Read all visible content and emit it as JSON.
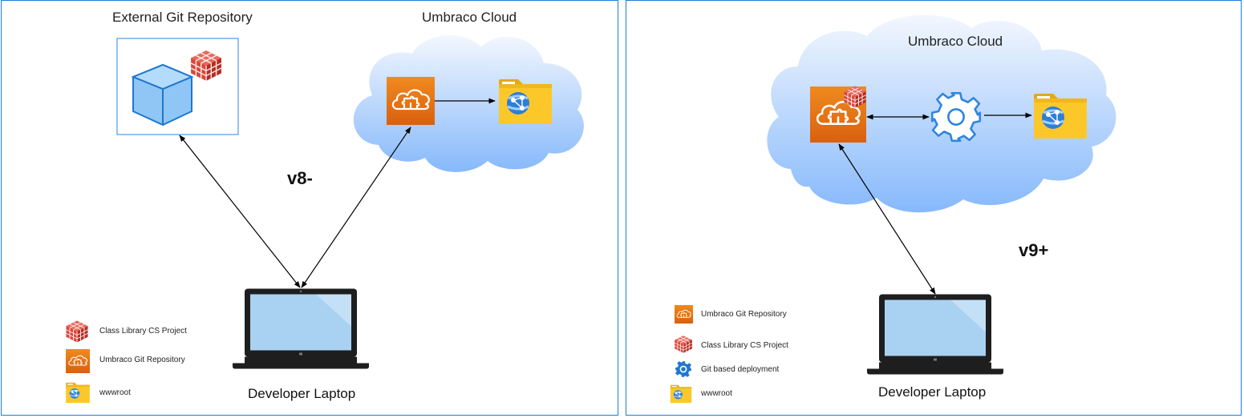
{
  "left": {
    "git_repo_title": "External Git Repository",
    "cloud_title": "Umbraco Cloud",
    "version_label": "v8-",
    "laptop_label": "Developer Laptop",
    "legend": {
      "class_library": "Class Library CS Project",
      "umbraco_git": "Umbraco Git Repository",
      "wwwroot": "wwwroot"
    }
  },
  "right": {
    "cloud_title": "Umbraco Cloud",
    "version_label": "v9+",
    "laptop_label": "Developer Laptop",
    "legend": {
      "umbraco_git": "Umbraco Git Repository",
      "class_library": "Class Library CS Project",
      "git_deploy": "Git based deployment",
      "wwwroot": "wwwroot"
    }
  },
  "icons": {
    "cube": "cube-icon",
    "brick": "brick-stack-icon",
    "umbraco": "cloud-puzzle-icon",
    "folder": "web-folder-icon",
    "gear": "gear-icon",
    "laptop": "laptop-icon"
  },
  "colors": {
    "border_blue": "#1c7ed6",
    "cloud_top": "#eef4fd",
    "cloud_bottom": "#8dbefb",
    "umbraco_orange": "#e46f15",
    "brick_red": "#c9362b",
    "folder_yellow": "#fcc829",
    "cube_blue": "#8fc6f5",
    "laptop_screen": "#a8d0f0"
  }
}
